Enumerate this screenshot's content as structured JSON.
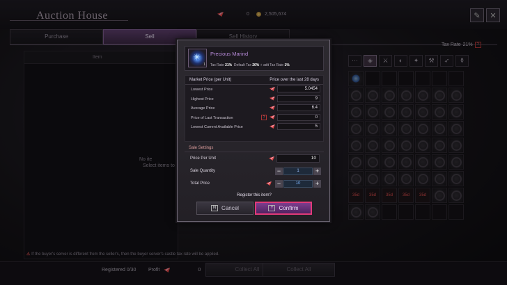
{
  "window": {
    "title": "Auction House"
  },
  "currency": {
    "pen_amount": "0",
    "gold_amount": "2,505,674"
  },
  "tabs": [
    {
      "label": "Purchase"
    },
    {
      "label": "Sell",
      "active": true
    },
    {
      "label": "Sell History"
    }
  ],
  "list": {
    "header_item": "Item",
    "empty_line1": "No ite",
    "empty_line2": "Select items to se"
  },
  "notice": "If the buyer's server is different from the seller's, then the buyer server's castle tax rate will be applied.",
  "bottom": {
    "registered_label": "Registered",
    "registered_value": "0/30",
    "profit_label": "Profit",
    "profit_value": "0",
    "collect_all_1": "Collect All",
    "collect_all_2": "Collect All"
  },
  "tax_rate": {
    "label": "Tax Rate",
    "value": "21%"
  },
  "inventory": {
    "red_labels": [
      "35d",
      "35d",
      "35d",
      "35d",
      "35d",
      "35d",
      "35d"
    ]
  },
  "modal": {
    "item_name": "Precious Marind",
    "item_level": "1",
    "tax_rate_label": "Tax Rate",
    "tax_rate_value": "21%",
    "default_tax_label": "Default Tax",
    "default_tax_value": "20%",
    "add_tax_label": "+ adit Tax Rate",
    "add_tax_value": "1%",
    "market_header": "Market Price (per Unit)",
    "market_period": "Price over the last 28 days",
    "market_rows": [
      {
        "label": "Lowest Price",
        "value": "5.0454"
      },
      {
        "label": "Highest Price",
        "value": "9"
      },
      {
        "label": "Average Price",
        "value": "6.4"
      },
      {
        "label": "Price of Last Transaction",
        "value": "0"
      },
      {
        "label": "Lowest Current Available Price",
        "value": "5"
      }
    ],
    "sale_settings_title": "Sale Settings",
    "price_per_unit_label": "Price Per Unit",
    "price_per_unit_value": "10",
    "sale_quantity_label": "Sale Quantity",
    "sale_quantity_value": "1",
    "total_price_label": "Total Price",
    "total_price_value": "10",
    "register_question": "Register this item?",
    "cancel_key": "N",
    "cancel_label": "Cancel",
    "confirm_key": "Y",
    "confirm_label": "Confirm"
  },
  "colors": {
    "accent": "#7c3d8d",
    "confirm_border": "#e23a7a",
    "item_name": "#b78ad8"
  }
}
